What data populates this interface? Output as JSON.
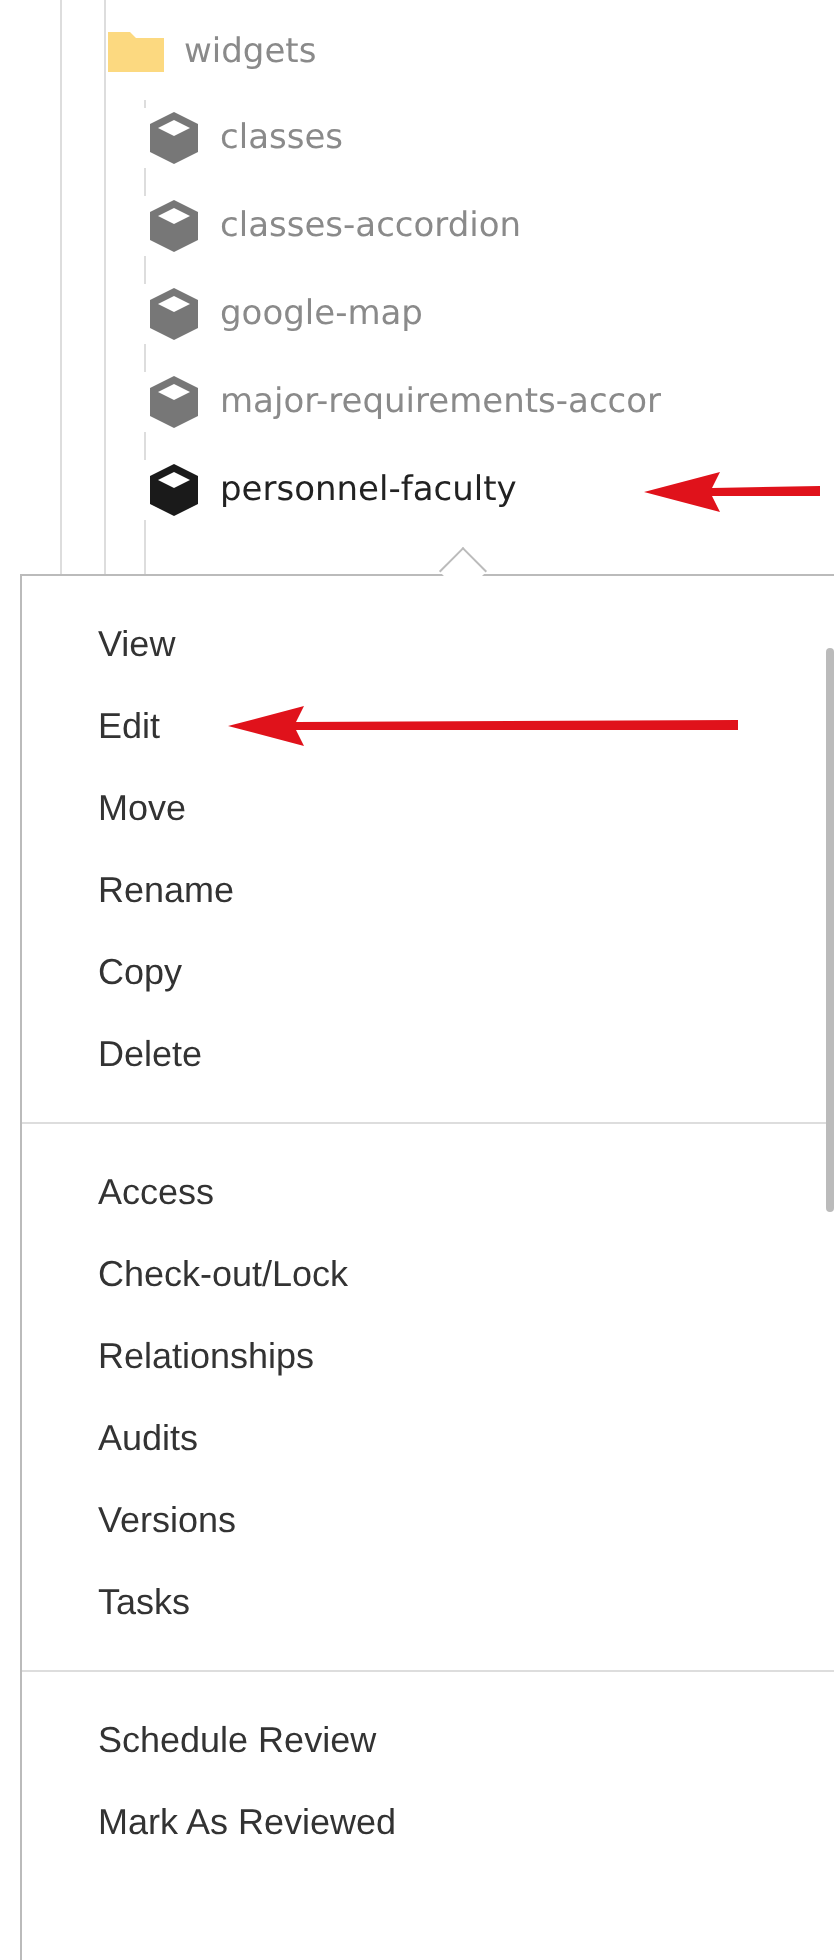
{
  "tree": {
    "folder": {
      "label": "widgets"
    },
    "children": [
      {
        "label": "classes",
        "highlighted": false,
        "arrow": false
      },
      {
        "label": "classes-accordion",
        "highlighted": false,
        "arrow": false
      },
      {
        "label": "google-map",
        "highlighted": false,
        "arrow": false
      },
      {
        "label": "major-requirements-accor",
        "highlighted": false,
        "arrow": false
      },
      {
        "label": "personnel-faculty",
        "highlighted": true,
        "arrow": true
      }
    ]
  },
  "context_menu": {
    "groups": [
      [
        {
          "label": "View",
          "arrow": false
        },
        {
          "label": "Edit",
          "arrow": true
        },
        {
          "label": "Move",
          "arrow": false
        },
        {
          "label": "Rename",
          "arrow": false
        },
        {
          "label": "Copy",
          "arrow": false
        },
        {
          "label": "Delete",
          "arrow": false
        }
      ],
      [
        {
          "label": "Access",
          "arrow": false
        },
        {
          "label": "Check-out/Lock",
          "arrow": false
        },
        {
          "label": "Relationships",
          "arrow": false
        },
        {
          "label": "Audits",
          "arrow": false
        },
        {
          "label": "Versions",
          "arrow": false
        },
        {
          "label": "Tasks",
          "arrow": false
        }
      ],
      [
        {
          "label": "Schedule Review",
          "arrow": false
        },
        {
          "label": "Mark As Reviewed",
          "arrow": false
        }
      ]
    ]
  }
}
